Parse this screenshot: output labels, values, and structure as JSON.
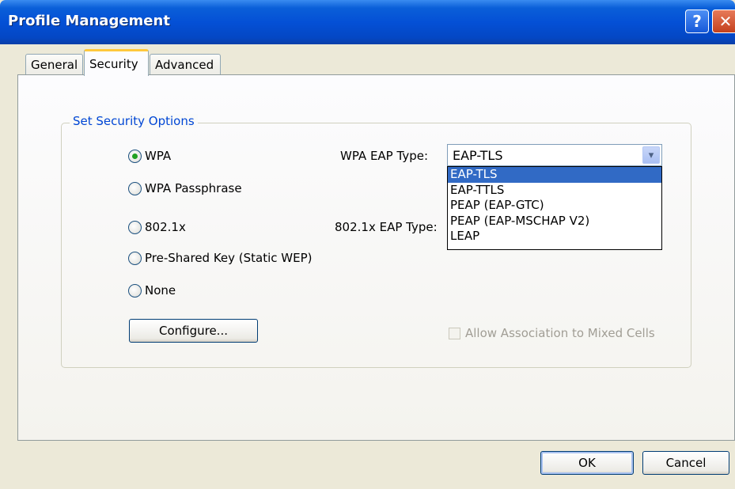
{
  "window": {
    "title": "Profile Management"
  },
  "tabs": [
    "General",
    "Security",
    "Advanced"
  ],
  "group": {
    "title": "Set Security Options"
  },
  "options": [
    "WPA",
    "WPA Passphrase",
    "802.1x",
    "Pre-Shared Key (Static WEP)",
    "None"
  ],
  "selected_option": "WPA",
  "wpa_eap": {
    "label": "WPA EAP Type:",
    "value": "EAP-TLS",
    "options": [
      "EAP-TLS",
      "EAP-TTLS",
      "PEAP (EAP-GTC)",
      "PEAP (EAP-MSCHAP V2)",
      "LEAP"
    ],
    "highlighted": "EAP-TLS"
  },
  "dot1x_eap": {
    "label": "802.1x EAP Type:"
  },
  "configure_button": "Configure...",
  "mixed_cells": {
    "label": "Allow Association to Mixed Cells",
    "checked": false,
    "enabled": false
  },
  "footer": {
    "ok": "OK",
    "cancel": "Cancel"
  },
  "colors": {
    "title_bar": "#0450d6",
    "group_title": "#0046d5",
    "selection": "#316ac5",
    "tab_accent": "#ffc83c"
  }
}
